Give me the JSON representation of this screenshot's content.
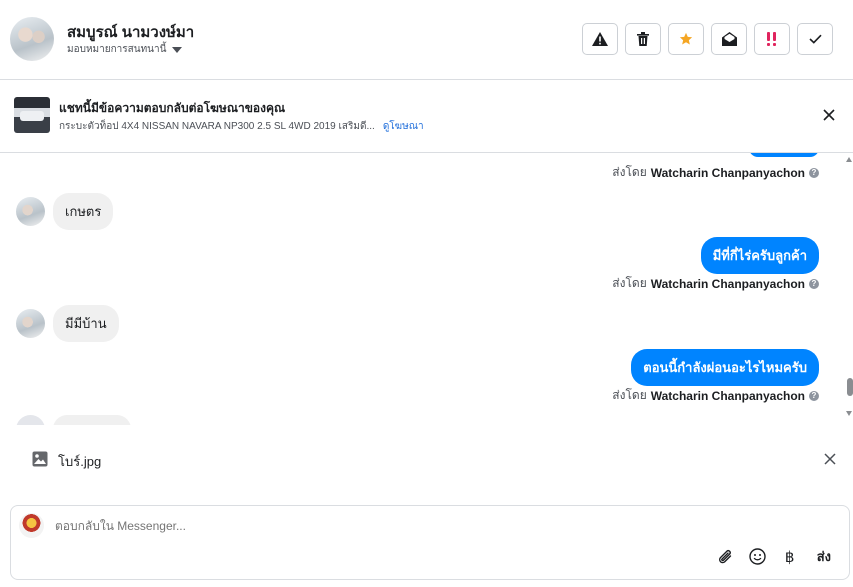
{
  "header": {
    "contact_name": "สมบูรณ์ นามวงษ์มา",
    "assign_label": "มอบหมายการสนทนานี้",
    "actions": [
      {
        "icon": "warning-icon"
      },
      {
        "icon": "trash-icon"
      },
      {
        "icon": "star-icon",
        "color": "#f5a623"
      },
      {
        "icon": "envelope-open-icon"
      },
      {
        "icon": "exclamation-icon",
        "color": "#e0245e"
      },
      {
        "icon": "check-icon"
      }
    ]
  },
  "ad_banner": {
    "title": "แชทนี้มีข้อความตอบกลับต่อโฆษณาของคุณ",
    "subtitle": "กระบะตัวท็อป 4X4 NISSAN NAVARA NP300 2.5 SL 4WD 2019 เสริมดี...",
    "link": "ดูโฆษณา"
  },
  "thread": {
    "sent_by_prefix": "ส่งโดย",
    "agent_name": "Watcharin Chanpanyachon",
    "messages": [
      {
        "direction": "in",
        "text": "เกษตร"
      },
      {
        "direction": "out",
        "text": "มีที่กี่ไร่ครับลูกค้า"
      },
      {
        "direction": "in",
        "text": "มีมีบ้าน"
      },
      {
        "direction": "out",
        "text": "ตอนนี้กำลังผ่อนอะไรไหมครับ"
      }
    ]
  },
  "attachment": {
    "filename": "โบร์.jpg"
  },
  "composer": {
    "placeholder": "ตอบกลับใน Messenger...",
    "send_label": "ส่ง"
  },
  "colors": {
    "outgoing_bubble": "#0084ff",
    "incoming_bubble": "#f0f0f0",
    "link": "#216fdb"
  }
}
